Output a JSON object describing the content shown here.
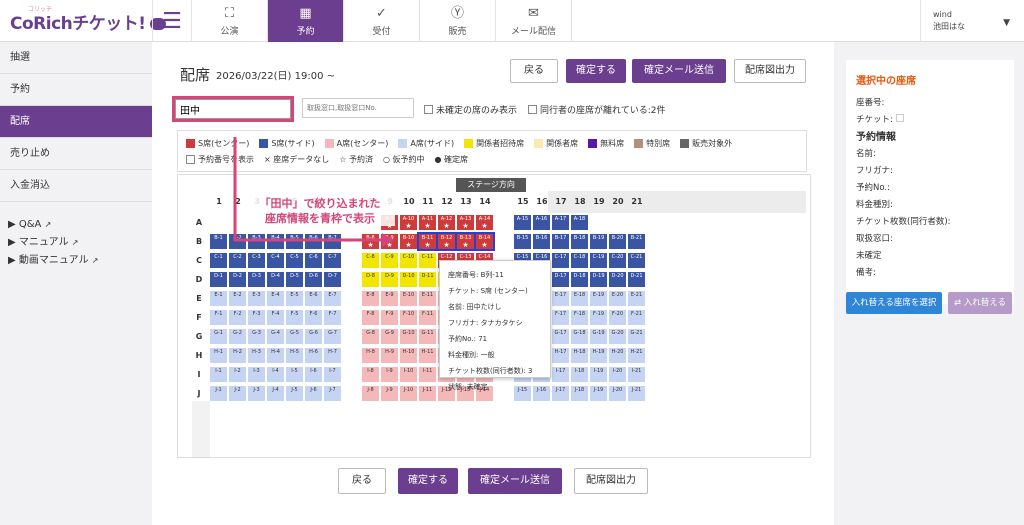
{
  "app": {
    "logo": "CoRichチケット!",
    "logo_ruby": "コリッチ"
  },
  "nav": [
    {
      "label": "公演",
      "icon": "theater-icon"
    },
    {
      "label": "予約",
      "icon": "calendar-icon"
    },
    {
      "label": "受付",
      "icon": "check-icon"
    },
    {
      "label": "販売",
      "icon": "yen-icon"
    },
    {
      "label": "メール配信",
      "icon": "mail-icon"
    }
  ],
  "user": {
    "org": "wind",
    "name": "池田はな"
  },
  "sidebar": {
    "items": [
      "抽選",
      "予約",
      "配席",
      "売り止め",
      "入金消込"
    ],
    "links": [
      "▶ Q&A",
      "▶ マニュアル",
      "▶ 動画マニュアル"
    ]
  },
  "page": {
    "title": "配席",
    "date": "2026/03/22(日) 19:00 ~"
  },
  "buttons": {
    "back": "戻る",
    "confirm": "確定する",
    "confirm_mail": "確定メール送信",
    "print": "配席図出力"
  },
  "search": {
    "value": "田中",
    "placeholder": "取扱窓口,取扱窓口No."
  },
  "filters": {
    "unconfirmed_only": "未確定の席のみ表示",
    "companions_apart": "同行者の座席が離れている:2件"
  },
  "legend": {
    "items": [
      {
        "label": "S席(センター)",
        "color": "#cf3a3a"
      },
      {
        "label": "S席(サイド)",
        "color": "#3b55a5"
      },
      {
        "label": "A席(センター)",
        "color": "#f4b8b8"
      },
      {
        "label": "A席(サイド)",
        "color": "#c5d4f2"
      },
      {
        "label": "関係者招待席",
        "color": "#f2e600"
      },
      {
        "label": "関係者席",
        "color": "#fbe9b0"
      },
      {
        "label": "無料席",
        "color": "#5b15a8"
      },
      {
        "label": "特別席",
        "color": "#b58f7d"
      },
      {
        "label": "販売対象外",
        "color": "#666666"
      }
    ],
    "row2": [
      "予約番号を表示",
      "× 座席データなし",
      "☆ 予約済",
      "○ 仮予約中",
      "● 確定席"
    ]
  },
  "stage": "ステージ方向",
  "columns": [
    "1",
    "2",
    "3",
    "4",
    "5",
    "6",
    "7",
    "8",
    "9",
    "10",
    "11",
    "12",
    "13",
    "14",
    "15",
    "16",
    "17",
    "18",
    "19",
    "20",
    "21"
  ],
  "rows": [
    "A",
    "B",
    "C",
    "D",
    "E",
    "F",
    "G",
    "H",
    "I",
    "J"
  ],
  "callout": "「田中」で絞り込まれた\n座席情報を青枠で表示",
  "tooltip": {
    "seat": "座席番号: B列-11",
    "ticket": "チケット: S席 (センター)",
    "name": "名前: 田中たけし",
    "kana": "フリガナ: タナカタケシ",
    "res_no": "予約No.: 71",
    "fee": "料金種別: 一般",
    "count": "チケット枚数(同行者数): 3",
    "status": "状態: 未確定"
  },
  "panel": {
    "title": "選択中の座席",
    "seat_no": "座番号:",
    "ticket": "チケット:",
    "res_info": "予約情報",
    "fields": [
      "名前:",
      "フリガナ:",
      "予約No.:",
      "料金種別:",
      "チケット枚数(同行者数):",
      "取扱窓口:",
      "未確定",
      "備考:"
    ],
    "swap_select": "入れ替える座席を選択",
    "swap": "入れ替える"
  }
}
